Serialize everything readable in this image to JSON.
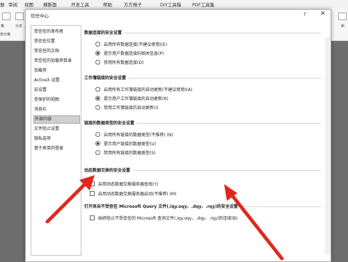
{
  "ribbon": {
    "tabs": [
      "据",
      "审阅",
      "视图",
      "横断面",
      "开发工具",
      "帮助",
      "方方格子",
      "DIY工具箱",
      "PDF工具集"
    ],
    "labels": [
      "格",
      "单元格",
      "分享",
      "新"
    ]
  },
  "dialog": {
    "title": "信任中心",
    "help_label": "?",
    "close_label": "✕"
  },
  "nav": {
    "items": [
      {
        "label": "受信任的发布者"
      },
      {
        "label": "受信任位置"
      },
      {
        "label": "受信任的文档"
      },
      {
        "label": "受信任的加载项目录"
      },
      {
        "label": "加载项"
      },
      {
        "label": "ActiveX 设置"
      },
      {
        "label": "宏设置"
      },
      {
        "label": "受保护的视图"
      },
      {
        "label": "消息栏"
      },
      {
        "label": "外部内容"
      },
      {
        "label": "文件阻止设置"
      },
      {
        "label": "隐私选项"
      },
      {
        "label": "基于表单的登录"
      }
    ],
    "selected_index": 9
  },
  "sections": {
    "data_conn": {
      "title": "数据连接的安全设置",
      "options": [
        {
          "label": "启用所有数据连接(不建议使用)(E)",
          "selected": false
        },
        {
          "label": "提示用户数据连接的相关信息(P)",
          "selected": true
        },
        {
          "label": "禁用所有数据连接(D)",
          "selected": false
        }
      ]
    },
    "workbook_links": {
      "title": "工作簿链接的安全设置",
      "options": [
        {
          "label": "启用所有工作簿链接的自动更新(不建议使用)(A)",
          "selected": false
        },
        {
          "label": "提示用户工作簿链接的自动更新(R)",
          "selected": true
        },
        {
          "label": "禁用工作簿链接的自动更新(I)",
          "selected": false
        }
      ]
    },
    "linked_types": {
      "title": "链接的数据类型的安全设置",
      "options": [
        {
          "label": "启用所有链接的数据类型(不推荐) (N)",
          "selected": false
        },
        {
          "label": "提示用户链接的数据类型(U)",
          "selected": true
        },
        {
          "label": "禁用所有链接的数据类型(S)",
          "selected": false
        }
      ]
    },
    "dde": {
      "title": "动态数据交换的安全设置",
      "options": [
        {
          "label": "启用动态数据交换服务器查找(Y)",
          "checked": false
        },
        {
          "label": "启用动态数据交换服务器启动(不推荐) (M)",
          "checked": false
        }
      ]
    },
    "mq": {
      "title": "打开来自不受信任 Microsoft Query 文件(.iqy.oqy、.dqy、.rqy)的安全设置",
      "options": [
        {
          "label": "始终阻止不受信任的 Microsoft 查询文件(.iqy.oqy、.dqy、.rqy)的连接(B)",
          "checked": false
        }
      ]
    }
  },
  "colors": {
    "arrow": "#e0281f",
    "selected_nav": "#d0d0d0"
  }
}
